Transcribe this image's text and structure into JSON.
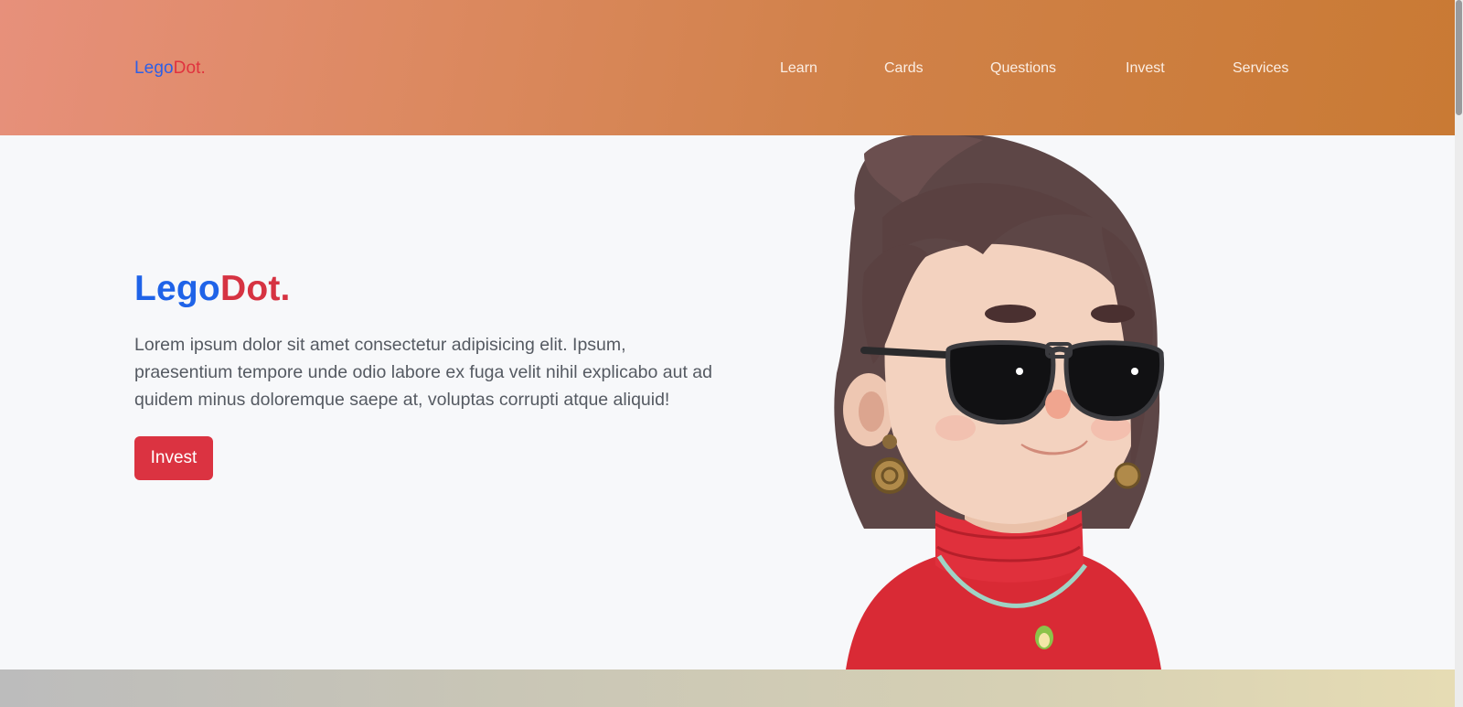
{
  "navbar": {
    "brand": {
      "part1": "Lego",
      "part2": "Dot."
    },
    "links": [
      {
        "label": "Learn"
      },
      {
        "label": "Cards"
      },
      {
        "label": "Questions"
      },
      {
        "label": "Invest"
      },
      {
        "label": "Services"
      }
    ]
  },
  "hero": {
    "title": {
      "part1": "Lego",
      "part2": "Dot."
    },
    "text": "Lorem ipsum dolor sit amet consectetur adipisicing elit. Ipsum, praesentium tempore unde odio labore ex fuga velit nihil explicabo aut ad quidem minus doloremque saepe at, voluptas corrupti atque aliquid!",
    "button_label": "Invest",
    "image": "avatar-woman-sunglasses-red-sweater"
  },
  "colors": {
    "brand_blue": "#1f63e8",
    "brand_red": "#d63342",
    "button": "#db3341",
    "nav_gradient_start": "#e7907b",
    "nav_gradient_end": "#c97a34"
  }
}
